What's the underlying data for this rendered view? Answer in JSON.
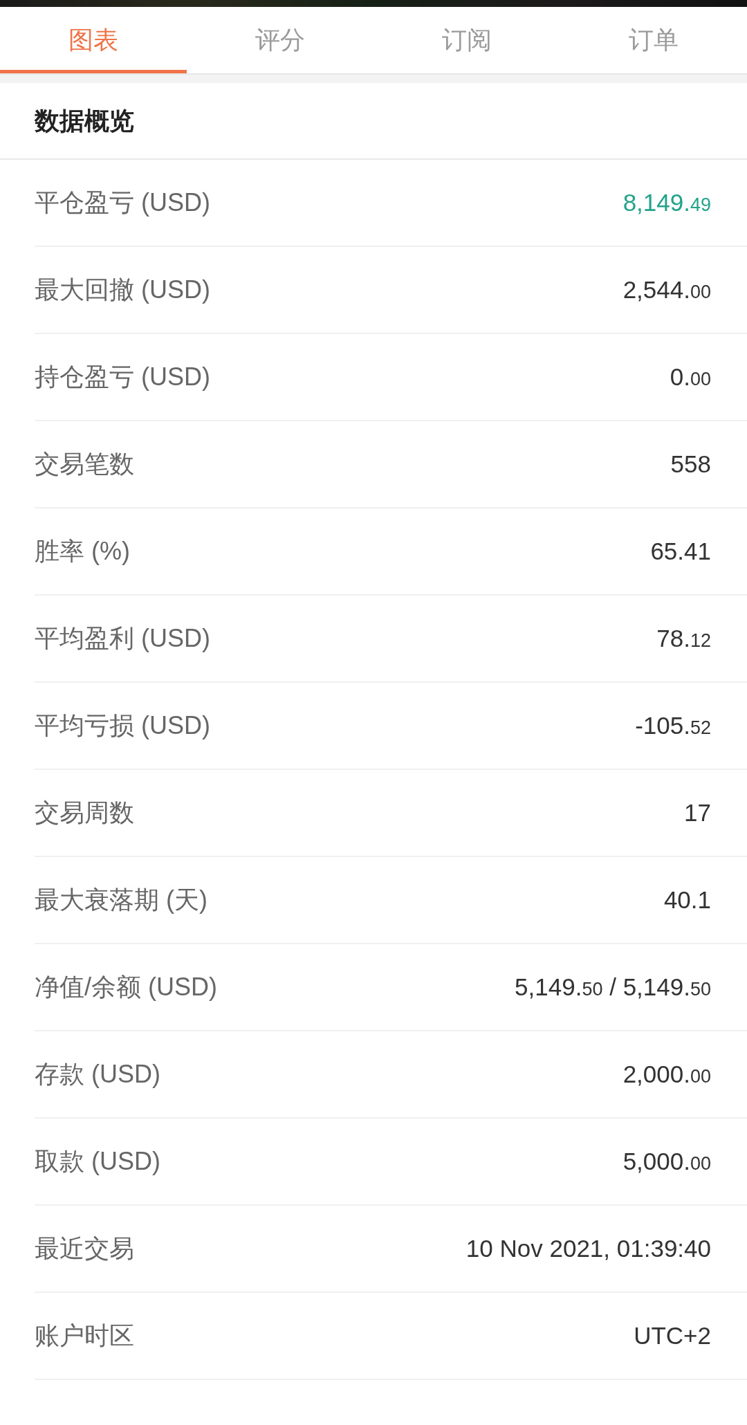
{
  "tabs": [
    {
      "label": "图表",
      "selected": true
    },
    {
      "label": "评分",
      "selected": false
    },
    {
      "label": "订阅",
      "selected": false
    },
    {
      "label": "订单",
      "selected": false
    }
  ],
  "overview": {
    "title": "数据概览",
    "rows": [
      {
        "label": "平仓盈亏 (USD)",
        "color": "#22a38a",
        "value": [
          {
            "whole": "8,149.",
            "decimals": "49"
          }
        ]
      },
      {
        "label": "最大回撤 (USD)",
        "color": "#333333",
        "value": [
          {
            "whole": "2,544.",
            "decimals": "00"
          }
        ]
      },
      {
        "label": "持仓盈亏 (USD)",
        "color": "#333333",
        "value": [
          {
            "whole": "0.",
            "decimals": "00"
          }
        ]
      },
      {
        "label": "交易笔数",
        "color": "#333333",
        "value": [
          {
            "whole": "558"
          }
        ]
      },
      {
        "label": "胜率 (%)",
        "color": "#333333",
        "value": [
          {
            "whole": "65.41"
          }
        ]
      },
      {
        "label": "平均盈利 (USD)",
        "color": "#333333",
        "value": [
          {
            "whole": "78.",
            "decimals": "12"
          }
        ]
      },
      {
        "label": "平均亏损 (USD)",
        "color": "#333333",
        "value": [
          {
            "whole": "-105.",
            "decimals": "52"
          }
        ]
      },
      {
        "label": "交易周数",
        "color": "#333333",
        "value": [
          {
            "whole": "17"
          }
        ]
      },
      {
        "label": "最大衰落期 (天)",
        "color": "#333333",
        "value": [
          {
            "whole": "40.1"
          }
        ]
      },
      {
        "label": "净值/余额 (USD)",
        "color": "#333333",
        "value": [
          {
            "whole": "5,149.",
            "decimals": "50"
          },
          {
            "whole": "/"
          },
          {
            "whole": "5,149.",
            "decimals": "50"
          }
        ]
      },
      {
        "label": "存款 (USD)",
        "color": "#333333",
        "value": [
          {
            "whole": "2,000.",
            "decimals": "00"
          }
        ]
      },
      {
        "label": "取款 (USD)",
        "color": "#333333",
        "value": [
          {
            "whole": "5,000.",
            "decimals": "00"
          }
        ]
      },
      {
        "label": "最近交易",
        "color": "#333333",
        "value": [
          {
            "whole": "10 Nov 2021, 01:39:40"
          }
        ]
      },
      {
        "label": "账户时区",
        "color": "#333333",
        "value": [
          {
            "whole": "UTC+2"
          }
        ]
      }
    ]
  }
}
